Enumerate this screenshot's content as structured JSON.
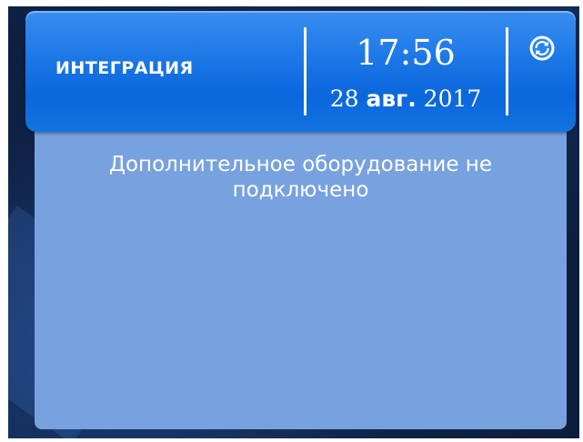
{
  "header": {
    "title": "ИНТЕГРАЦИЯ",
    "time": "17:56",
    "date_day": "28",
    "date_month": "авг.",
    "date_year": "2017",
    "sync_icon": "sync-icon"
  },
  "main": {
    "message": "Дополнительное оборудование не подключено"
  },
  "colors": {
    "header_blue": "#1f7ae8",
    "panel_blue": "#77a2df",
    "background_dark": "#0f2247"
  }
}
